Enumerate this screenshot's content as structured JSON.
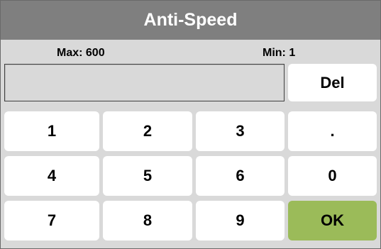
{
  "dialog": {
    "title": "Anti-Speed",
    "max_label": "Max: 600",
    "min_label": "Min: 1",
    "entry_value": ""
  },
  "keypad": {
    "del": "Del",
    "k1": "1",
    "k2": "2",
    "k3": "3",
    "dot": ".",
    "k4": "4",
    "k5": "5",
    "k6": "6",
    "k0": "0",
    "k7": "7",
    "k8": "8",
    "k9": "9",
    "ok": "OK"
  },
  "colors": {
    "title_bar": "#7f7f7f",
    "panel": "#d9d9d9",
    "key": "#ffffff",
    "ok_key": "#9bbb59"
  }
}
